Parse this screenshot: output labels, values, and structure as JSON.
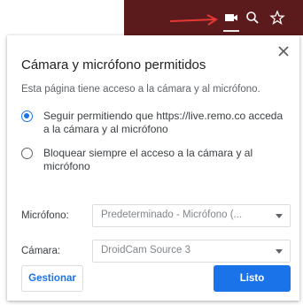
{
  "toolbar": {
    "background": "#5b1a1c",
    "icons": [
      "camera-icon",
      "search-icon",
      "star-icon"
    ],
    "annotation_color": "#e53935"
  },
  "popup": {
    "title": "Cámara y micrófono permitidos",
    "description": "Esta página tiene acceso a la cámara y al micrófono.",
    "options": [
      {
        "label": "Seguir permitiendo que https://live.remo.co acceda a la cámara y al micrófono",
        "checked": true
      },
      {
        "label": "Bloquear siempre el acceso a la cámara y al micrófono",
        "checked": false
      }
    ],
    "microphone": {
      "label": "Micrófono:",
      "value": "Predeterminado - Micrófono (..."
    },
    "camera": {
      "label": "Cámara:",
      "value": "DroidCam Source 3"
    },
    "manage_label": "Gestionar",
    "done_label": "Listo",
    "accent": "#1a73e8"
  }
}
